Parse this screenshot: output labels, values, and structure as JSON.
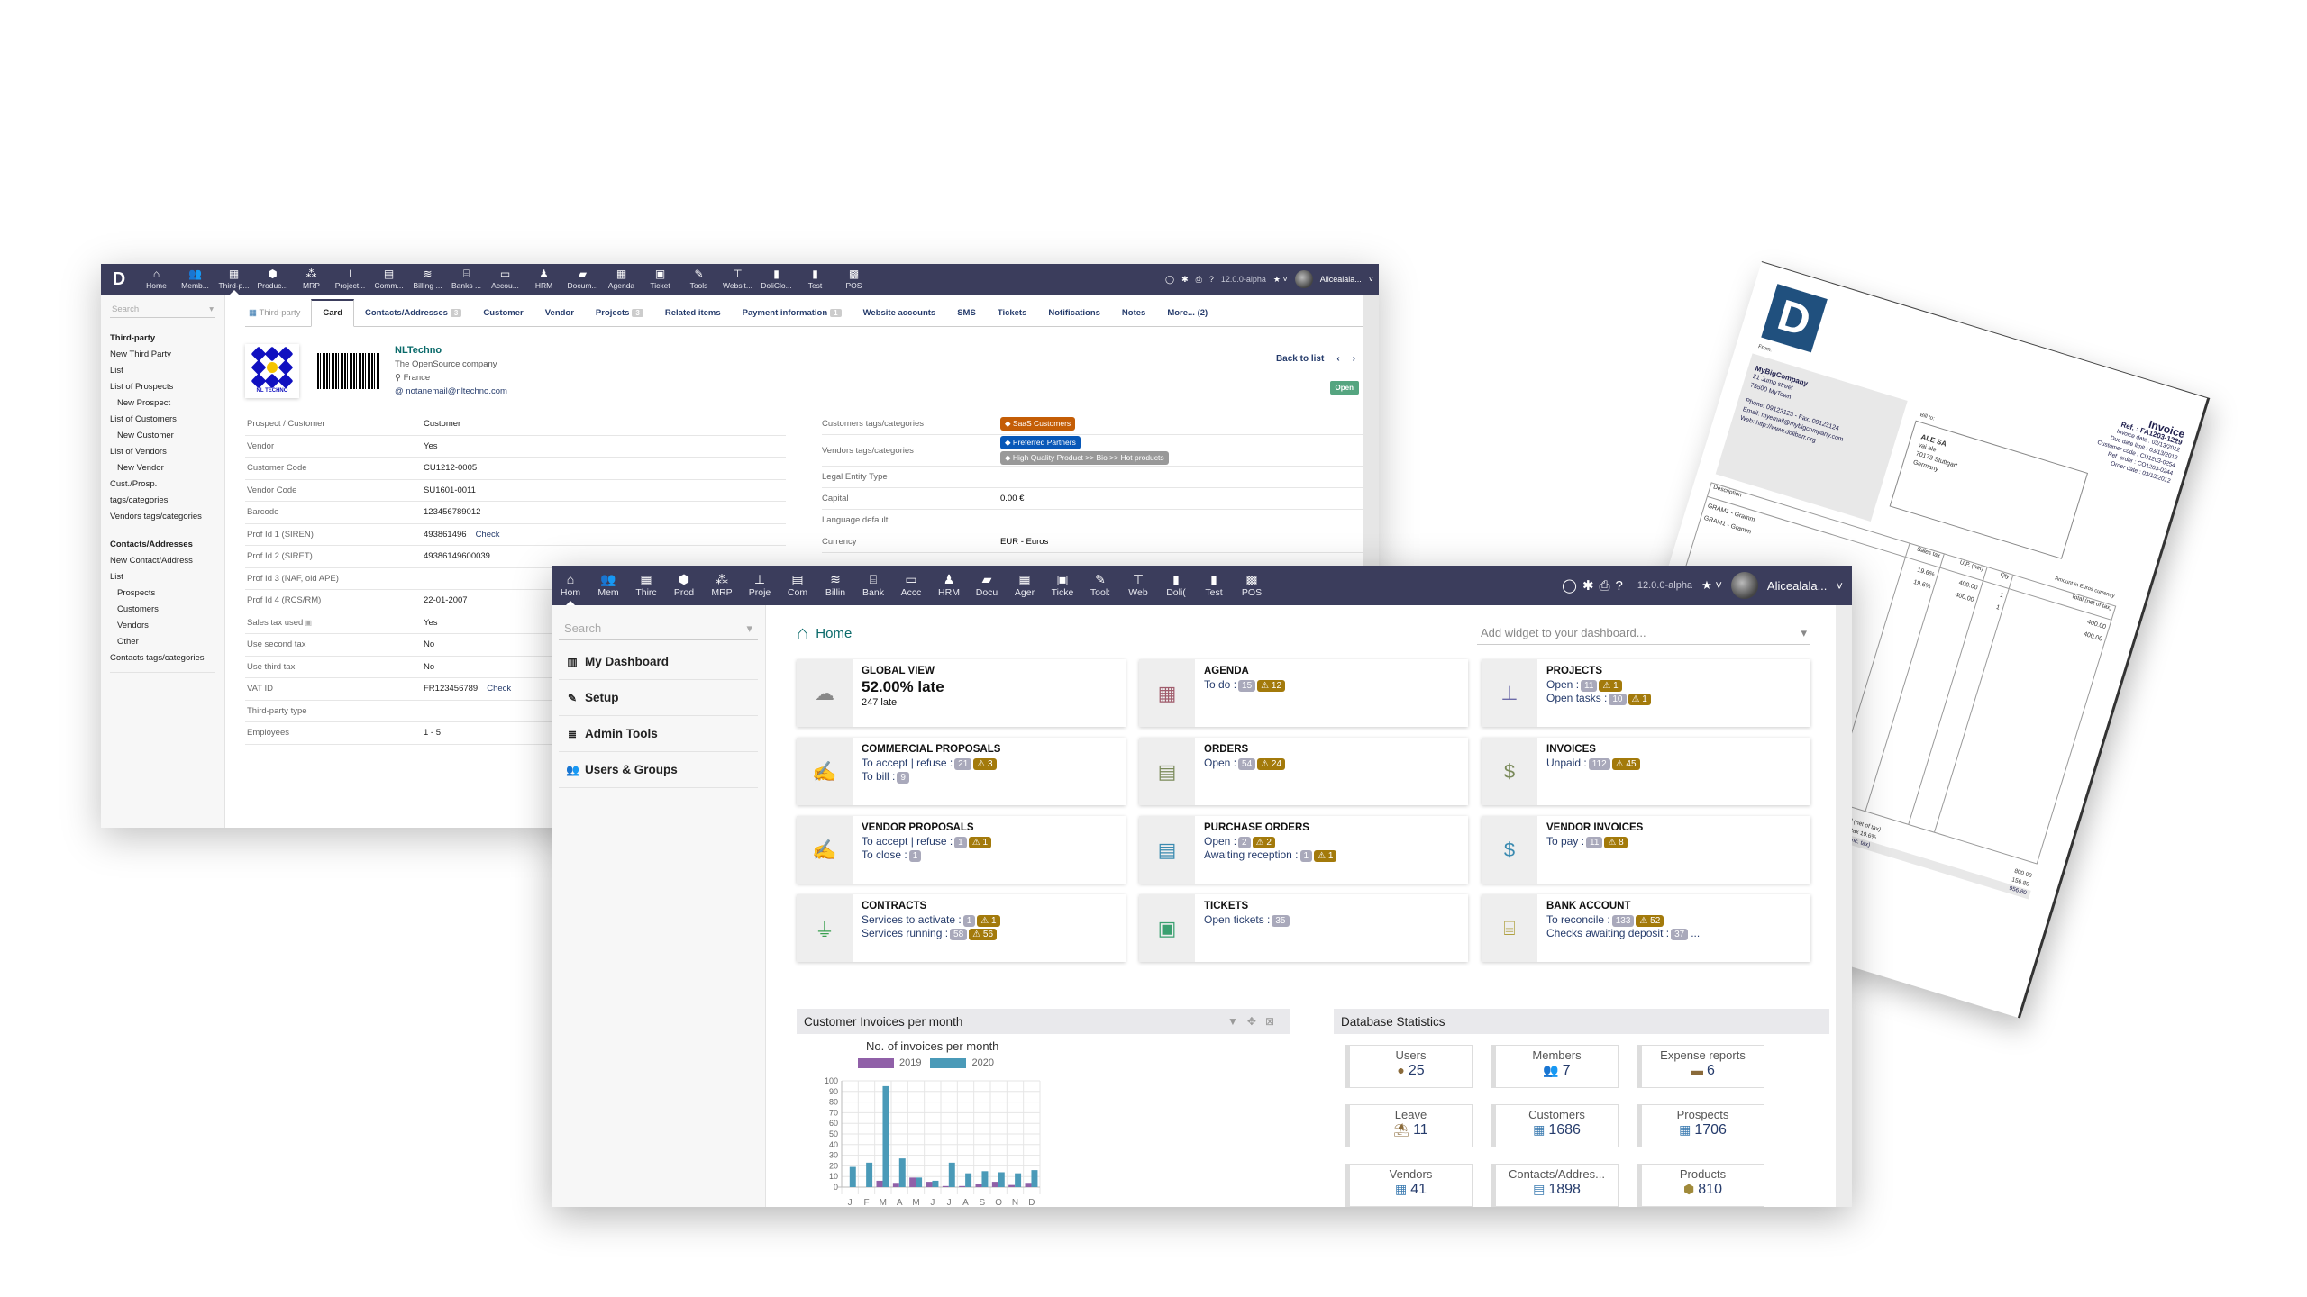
{
  "app": {
    "logo": "D",
    "version": "12.0.0-alpha",
    "user": "Alicealala...",
    "colors": {
      "topbar": "#3b3d5c",
      "accent_teal": "#0a6a6a",
      "link": "#263c6c",
      "warning_badge": "#a37a0b",
      "count_badge": "#a9a9bb",
      "status_open": "#55a580"
    }
  },
  "window_thirdparty": {
    "menu": [
      {
        "icon": "home-icon",
        "glyph": "⌂",
        "label": "Home"
      },
      {
        "icon": "members-icon",
        "glyph": "👥",
        "label": "Memb..."
      },
      {
        "icon": "building-icon",
        "glyph": "▦",
        "label": "Third-p...",
        "active": true
      },
      {
        "icon": "cube-icon",
        "glyph": "⬢",
        "label": "Produc..."
      },
      {
        "icon": "cubes-icon",
        "glyph": "⁂",
        "label": "MRP"
      },
      {
        "icon": "sitemap-icon",
        "glyph": "⊥",
        "label": "Project..."
      },
      {
        "icon": "suitcase-icon",
        "glyph": "▤",
        "label": "Comm..."
      },
      {
        "icon": "coins-icon",
        "glyph": "≋",
        "label": "Billing ..."
      },
      {
        "icon": "bank-icon",
        "glyph": "⌸",
        "label": "Banks ..."
      },
      {
        "icon": "money-check-icon",
        "glyph": "▭",
        "label": "Accou..."
      },
      {
        "icon": "user-tie-icon",
        "glyph": "♟",
        "label": "HRM"
      },
      {
        "icon": "folder-open-icon",
        "glyph": "▰",
        "label": "Docum..."
      },
      {
        "icon": "calendar-icon",
        "glyph": "▦",
        "label": "Agenda"
      },
      {
        "icon": "ticket-icon",
        "glyph": "▣",
        "label": "Ticket"
      },
      {
        "icon": "wrench-icon",
        "glyph": "✎",
        "label": "Tools"
      },
      {
        "icon": "sitemap-web-icon",
        "glyph": "⊤",
        "label": "Websit..."
      },
      {
        "icon": "file-icon",
        "glyph": "▮",
        "label": "DoliClo..."
      },
      {
        "icon": "file-icon",
        "glyph": "▮",
        "label": "Test"
      },
      {
        "icon": "cash-register-icon",
        "glyph": "▩",
        "label": "POS"
      }
    ],
    "sidebar": {
      "search_placeholder": "Search",
      "sections": [
        {
          "title": "Third-party",
          "items": [
            {
              "label": "New Third Party",
              "sub": false
            },
            {
              "label": "List",
              "sub": false
            },
            {
              "label": "List of Prospects",
              "sub": false
            },
            {
              "label": "New Prospect",
              "sub": true
            },
            {
              "label": "List of Customers",
              "sub": false
            },
            {
              "label": "New Customer",
              "sub": true
            },
            {
              "label": "List of Vendors",
              "sub": false
            },
            {
              "label": "New Vendor",
              "sub": true
            },
            {
              "label": "Cust./Prosp. tags/categories",
              "sub": false
            },
            {
              "label": "Vendors tags/categories",
              "sub": false
            }
          ]
        },
        {
          "title": "Contacts/Addresses",
          "items": [
            {
              "label": "New Contact/Address",
              "sub": false
            },
            {
              "label": "List",
              "sub": false
            },
            {
              "label": "Prospects",
              "sub": true
            },
            {
              "label": "Customers",
              "sub": true
            },
            {
              "label": "Vendors",
              "sub": true
            },
            {
              "label": "Other",
              "sub": true
            },
            {
              "label": "Contacts tags/categories",
              "sub": false
            }
          ]
        }
      ]
    },
    "tabs": [
      {
        "label": "Third-party",
        "kind": "first"
      },
      {
        "label": "Card",
        "kind": "active"
      },
      {
        "label": "Contacts/Addresses",
        "count": "3"
      },
      {
        "label": "Customer"
      },
      {
        "label": "Vendor"
      },
      {
        "label": "Projects",
        "count": "3"
      },
      {
        "label": "Related items"
      },
      {
        "label": "Payment information",
        "count": "1"
      },
      {
        "label": "Website accounts"
      },
      {
        "label": "SMS"
      },
      {
        "label": "Tickets"
      },
      {
        "label": "Notifications"
      },
      {
        "label": "Notes"
      },
      {
        "label": "More... (2)"
      }
    ],
    "company": {
      "name": "NLTechno",
      "slogan": "The OpenSource company",
      "country": "France",
      "email": "notanemail@nltechno.com",
      "logo_text": "NL TECHNO"
    },
    "back_to_list": "Back to list",
    "status": "Open",
    "fields_left": [
      {
        "k": "Prospect / Customer",
        "v": "Customer"
      },
      {
        "k": "Vendor",
        "v": "Yes"
      },
      {
        "k": "Customer Code",
        "v": "CU1212-0005"
      },
      {
        "k": "Vendor Code",
        "v": "SU1601-0011"
      },
      {
        "k": "Barcode",
        "v": "123456789012"
      },
      {
        "k": "Prof Id 1 (SIREN)",
        "v": "493861496",
        "link": "Check"
      },
      {
        "k": "Prof Id 2 (SIRET)",
        "v": "49386149600039"
      },
      {
        "k": "Prof Id 3 (NAF, old APE)",
        "v": ""
      },
      {
        "k": "Prof Id 4 (RCS/RM)",
        "v": "22-01-2007"
      },
      {
        "k": "Sales tax used",
        "v": "Yes",
        "help": true
      },
      {
        "k": "Use second tax",
        "v": "No"
      },
      {
        "k": "Use third tax",
        "v": "No"
      },
      {
        "k": "VAT ID",
        "v": "FR123456789",
        "link": "Check"
      },
      {
        "k": "Third-party type",
        "v": ""
      },
      {
        "k": "Employees",
        "v": "1 - 5"
      }
    ],
    "fields_right": [
      {
        "k": "Customers tags/categories",
        "tags": [
          {
            "label": "SaaS Customers",
            "color": "or"
          }
        ]
      },
      {
        "k": "Vendors tags/categories",
        "tags": [
          {
            "label": "Preferred Partners",
            "color": "bl"
          },
          {
            "label": "High Quality Product >> Bio >> Hot products",
            "color": "gr"
          }
        ]
      },
      {
        "k": "Legal Entity Type",
        "v": ""
      },
      {
        "k": "Capital",
        "v": "0.00 €"
      },
      {
        "k": "Language default",
        "v": ""
      },
      {
        "k": "Currency",
        "v": "EUR - Euros"
      }
    ]
  },
  "window_home": {
    "menu": [
      {
        "icon": "home-icon",
        "glyph": "⌂",
        "label": "Hom",
        "active": true
      },
      {
        "icon": "members-icon",
        "glyph": "👥",
        "label": "Mem"
      },
      {
        "icon": "building-icon",
        "glyph": "▦",
        "label": "Thirc"
      },
      {
        "icon": "cube-icon",
        "glyph": "⬢",
        "label": "Prod"
      },
      {
        "icon": "cubes-icon",
        "glyph": "⁂",
        "label": "MRP"
      },
      {
        "icon": "sitemap-icon",
        "glyph": "⊥",
        "label": "Proje"
      },
      {
        "icon": "suitcase-icon",
        "glyph": "▤",
        "label": "Com"
      },
      {
        "icon": "coins-icon",
        "glyph": "≋",
        "label": "Billin"
      },
      {
        "icon": "bank-icon",
        "glyph": "⌸",
        "label": "Bank"
      },
      {
        "icon": "money-check-icon",
        "glyph": "▭",
        "label": "Accc"
      },
      {
        "icon": "user-tie-icon",
        "glyph": "♟",
        "label": "HRM"
      },
      {
        "icon": "folder-open-icon",
        "glyph": "▰",
        "label": "Docu"
      },
      {
        "icon": "calendar-icon",
        "glyph": "▦",
        "label": "Ager"
      },
      {
        "icon": "ticket-icon",
        "glyph": "▣",
        "label": "Ticke"
      },
      {
        "icon": "wrench-icon",
        "glyph": "✎",
        "label": "Tool:"
      },
      {
        "icon": "sitemap-web-icon",
        "glyph": "⊤",
        "label": "Web"
      },
      {
        "icon": "file-icon",
        "glyph": "▮",
        "label": "Doli("
      },
      {
        "icon": "file-icon",
        "glyph": "▮",
        "label": "Test"
      },
      {
        "icon": "cash-register-icon",
        "glyph": "▩",
        "label": "POS"
      }
    ],
    "sidebar": {
      "search_placeholder": "Search",
      "items": [
        {
          "icon": "chart-icon",
          "glyph": "▥",
          "label": "My Dashboard"
        },
        {
          "icon": "wrench-icon",
          "glyph": "✎",
          "label": "Setup"
        },
        {
          "icon": "server-icon",
          "glyph": "≣",
          "label": "Admin Tools"
        },
        {
          "icon": "users-icon",
          "glyph": "👥",
          "label": "Users & Groups"
        }
      ]
    },
    "title": "Home",
    "widget_placeholder": "Add widget to your dashboard...",
    "boxes": [
      {
        "title": "GLOBAL VIEW",
        "big": "52.00% late",
        "small": "247 late",
        "icon": "weather-storm-icon",
        "glyph": "☁",
        "color": "#888888"
      },
      {
        "title": "AGENDA",
        "icon": "calendar-icon",
        "glyph": "▦",
        "color": "#a05c6c",
        "lines": [
          {
            "label": "To do :",
            "count": "15",
            "warn": "12"
          }
        ]
      },
      {
        "title": "PROJECTS",
        "icon": "sitemap-icon",
        "glyph": "⊥",
        "color": "#6c6aa8",
        "lines": [
          {
            "label": "Open :",
            "count": "11",
            "warn": "1"
          },
          {
            "label": "Open tasks :",
            "count": "10",
            "warn": "1"
          }
        ]
      },
      {
        "title": "COMMERCIAL PROPOSALS",
        "icon": "file-signature-icon",
        "glyph": "✍",
        "color": "#7a8a5a",
        "lines": [
          {
            "label": "To accept | refuse :",
            "count": "21",
            "warn": "3"
          },
          {
            "label": "To bill :",
            "count": "9"
          }
        ]
      },
      {
        "title": "ORDERS",
        "icon": "file-invoice-icon",
        "glyph": "▤",
        "color": "#7a8a5a",
        "lines": [
          {
            "label": "Open :",
            "count": "54",
            "warn": "24"
          }
        ]
      },
      {
        "title": "INVOICES",
        "icon": "file-dollar-icon",
        "glyph": "$",
        "color": "#7a8a5a",
        "lines": [
          {
            "label": "Unpaid :",
            "count": "112",
            "warn": "45"
          }
        ]
      },
      {
        "title": "VENDOR PROPOSALS",
        "icon": "file-signature-icon",
        "glyph": "✍",
        "color": "#3a8ab0",
        "lines": [
          {
            "label": "To accept | refuse :",
            "count": "1",
            "warn": "1"
          },
          {
            "label": "To close :",
            "count": "1"
          }
        ]
      },
      {
        "title": "PURCHASE ORDERS",
        "icon": "file-invoice-icon",
        "glyph": "▤",
        "color": "#3a8ab0",
        "lines": [
          {
            "label": "Open :",
            "count": "2",
            "warn": "2"
          },
          {
            "label": "Awaiting reception :",
            "count": "1",
            "warn": "1"
          }
        ]
      },
      {
        "title": "VENDOR INVOICES",
        "icon": "file-dollar-icon",
        "glyph": "$",
        "color": "#3a8ab0",
        "lines": [
          {
            "label": "To pay :",
            "count": "11",
            "warn": "8"
          }
        ]
      },
      {
        "title": "CONTRACTS",
        "icon": "plug-icon",
        "glyph": "⏚",
        "color": "#3aa050",
        "lines": [
          {
            "label": "Services to activate :",
            "count": "1",
            "warn": "1"
          },
          {
            "label": "Services running :",
            "count": "58",
            "warn": "56"
          }
        ]
      },
      {
        "title": "TICKETS",
        "icon": "ticket-icon",
        "glyph": "▣",
        "color": "#3aa070",
        "lines": [
          {
            "label": "Open tickets :",
            "count": "35"
          }
        ]
      },
      {
        "title": "BANK ACCOUNT",
        "icon": "bank-icon",
        "glyph": "⌸",
        "color": "#b0a040",
        "lines": [
          {
            "label": "To reconcile :",
            "count": "133",
            "warn": "52"
          },
          {
            "label": "Checks awaiting deposit :",
            "count": "37",
            "more": "..."
          }
        ]
      }
    ],
    "chart_panel_title": "Customer Invoices per month",
    "stats_panel_title": "Database Statistics",
    "stats": [
      {
        "label": "Users",
        "value": "25",
        "icon": "user-icon",
        "glyph": "●",
        "color": "#8a6a3a"
      },
      {
        "label": "Members",
        "value": "7",
        "icon": "members-icon",
        "glyph": "👥",
        "color": "#8a6a3a"
      },
      {
        "label": "Expense reports",
        "value": "6",
        "icon": "wallet-icon",
        "glyph": "▬",
        "color": "#8a6a3a"
      },
      {
        "label": "Leave",
        "value": "11",
        "icon": "umbrella-beach-icon",
        "glyph": "⛱",
        "color": "#8a6a3a"
      },
      {
        "label": "Customers",
        "value": "1686",
        "icon": "building-icon",
        "glyph": "▦",
        "color": "#3a7ab0"
      },
      {
        "label": "Prospects",
        "value": "1706",
        "icon": "building-icon",
        "glyph": "▦",
        "color": "#3a7ab0"
      },
      {
        "label": "Vendors",
        "value": "41",
        "icon": "building-icon",
        "glyph": "▦",
        "color": "#3a7ab0"
      },
      {
        "label": "Contacts/Addres...",
        "value": "1898",
        "icon": "address-card-icon",
        "glyph": "▤",
        "color": "#3a7ab0"
      },
      {
        "label": "Products",
        "value": "810",
        "icon": "cube-icon",
        "glyph": "⬢",
        "color": "#a08a3a"
      }
    ]
  },
  "chart_data": {
    "type": "bar",
    "title": "No. of invoices per month",
    "categories": [
      "J",
      "F",
      "M",
      "A",
      "M",
      "J",
      "J",
      "A",
      "S",
      "O",
      "N",
      "D"
    ],
    "series": [
      {
        "name": "2019",
        "color": "#9060a8",
        "values": [
          0,
          0,
          6,
          4,
          9,
          5,
          1,
          1,
          3,
          5,
          2,
          4
        ]
      },
      {
        "name": "2020",
        "color": "#4a9ab8",
        "values": [
          19,
          23,
          95,
          27,
          9,
          6,
          23,
          13,
          15,
          14,
          13,
          16
        ]
      }
    ],
    "xlabel": "",
    "ylabel": "",
    "ylim": [
      0,
      100
    ],
    "yticks": [
      0,
      10,
      20,
      30,
      40,
      50,
      60,
      70,
      80,
      90,
      100
    ],
    "grid": true,
    "legend": "top"
  },
  "invoice_doc": {
    "logo": "D",
    "from_label": "From:",
    "from": {
      "name": "MyBigCompany",
      "lines": [
        "21 Jump street",
        "75500 MyTown",
        "",
        "Phone: 09123123 - Fax: 09123124",
        "Email: myemail@mybigcompany.com",
        "Web: http://www.dolibarr.org"
      ]
    },
    "billto_label": "Bill to:",
    "billto": {
      "name": "ALE SA",
      "lines": [
        "vai.ale",
        "70173 Stuttgart",
        "Germany"
      ]
    },
    "header": {
      "title": "Invoice",
      "ref": "Ref. : FA1203-1229",
      "lines": [
        "Invoice date : 03/13/2012",
        "Due date limit : 03/13/2012",
        "Customer code : CU1203-0254",
        "Ref. order : CO1203-0244",
        "Order date : 03/13/2012"
      ]
    },
    "currency_note": "Amount in Euros currency",
    "columns": {
      "desc": "Description",
      "tax": "Sales tax",
      "up": "U.P. (net)",
      "qty": "Qty",
      "total": "Total (net of tax)"
    },
    "lines": [
      {
        "desc": "GRAM1 - Gramm",
        "tax": "19.6%",
        "up": "400.00",
        "qty": "1",
        "total": "400.00"
      },
      {
        "desc": "GRAM1 - Gramm",
        "tax": "19.6%",
        "up": "400.00",
        "qty": "1",
        "total": "400.00"
      }
    ],
    "totals": [
      {
        "label": "Total (net of tax)",
        "value": "800.00"
      },
      {
        "label": "Total tax 19.6%",
        "value": "156.80"
      },
      {
        "label": "Total (inc. tax)",
        "value": "956.80",
        "inc": true
      }
    ]
  }
}
